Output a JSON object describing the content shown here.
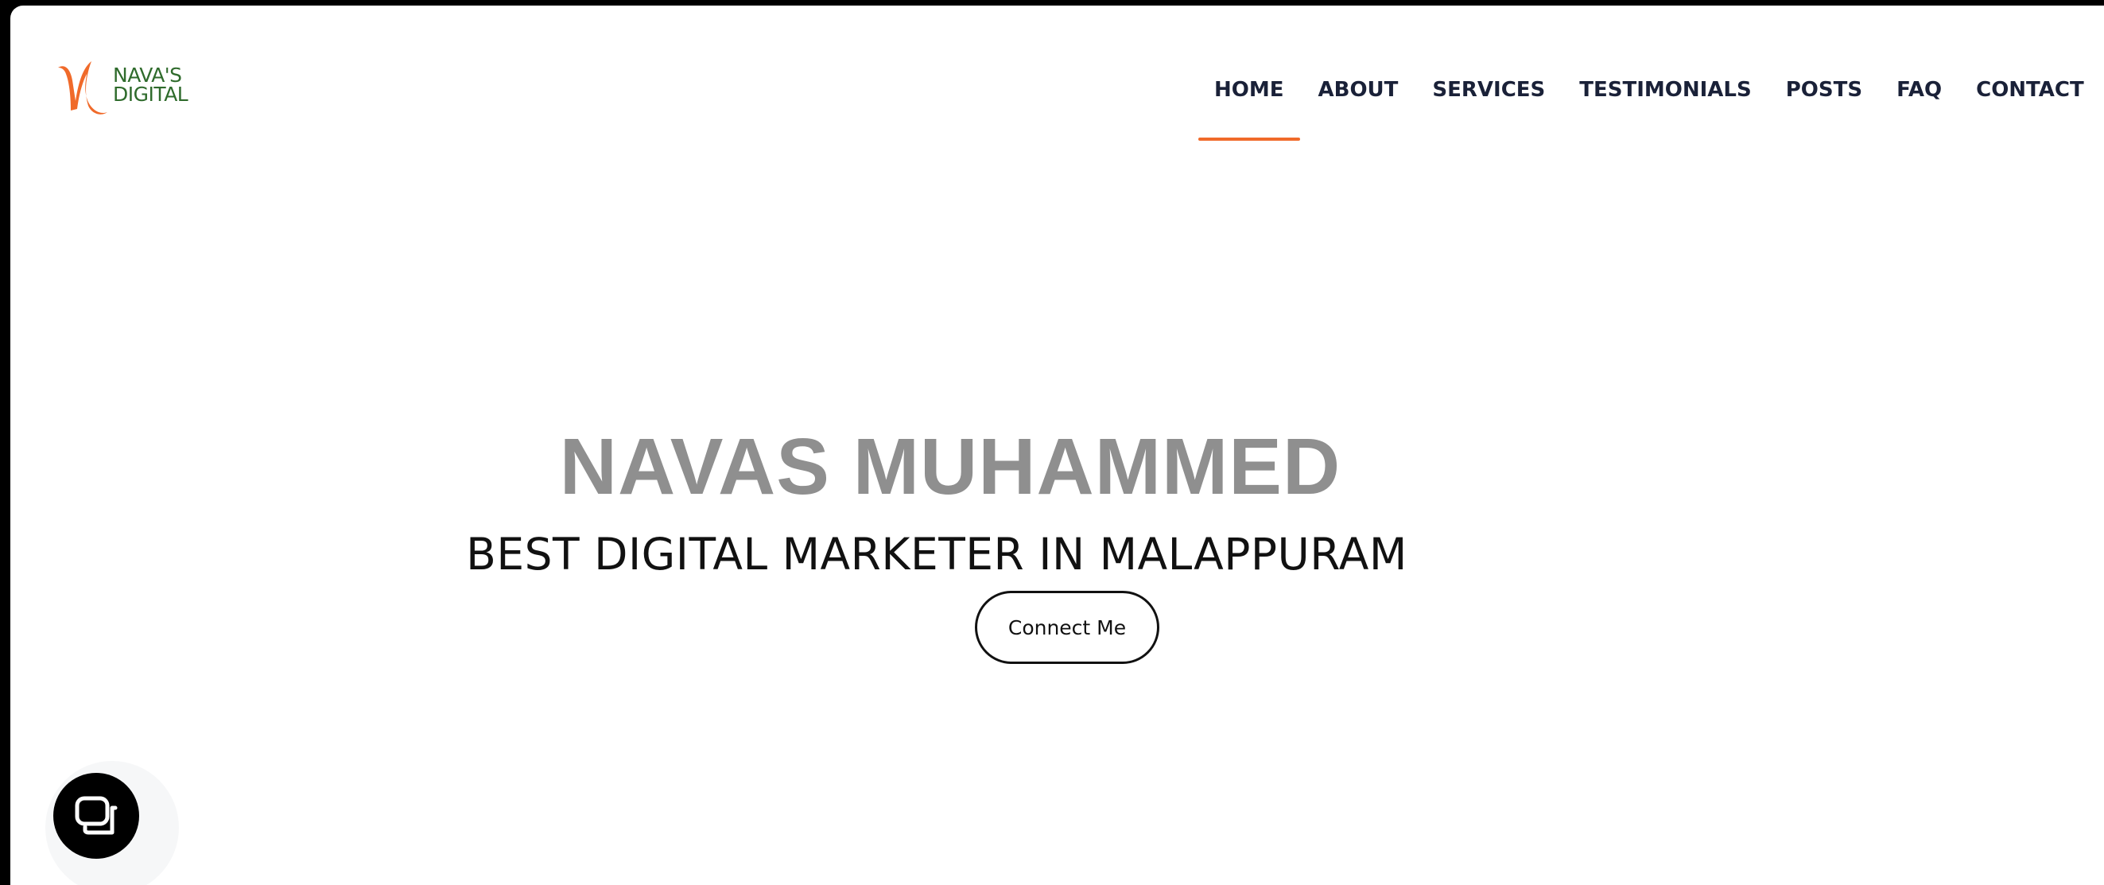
{
  "brand": {
    "line1": "NAVA'S",
    "line2": "DIGITAL",
    "accent_color": "#f06a2a",
    "text_color": "#2f6b2c"
  },
  "nav": {
    "items": [
      {
        "label": "HOME",
        "active": true
      },
      {
        "label": "ABOUT",
        "active": false
      },
      {
        "label": "SERVICES",
        "active": false
      },
      {
        "label": "TESTIMONIALS",
        "active": false
      },
      {
        "label": "POSTS",
        "active": false
      },
      {
        "label": "FAQ",
        "active": false
      },
      {
        "label": "CONTACT",
        "active": false
      }
    ],
    "active_indicator_color": "#f06a2a"
  },
  "hero": {
    "title": "NAVAS MUHAMMED",
    "subtitle": "BEST DIGITAL MARKETER IN MALAPPURAM",
    "cta_label": "Connect Me"
  },
  "chat_widget": {
    "icon": "chat-bubble-icon",
    "color": "#000000"
  }
}
